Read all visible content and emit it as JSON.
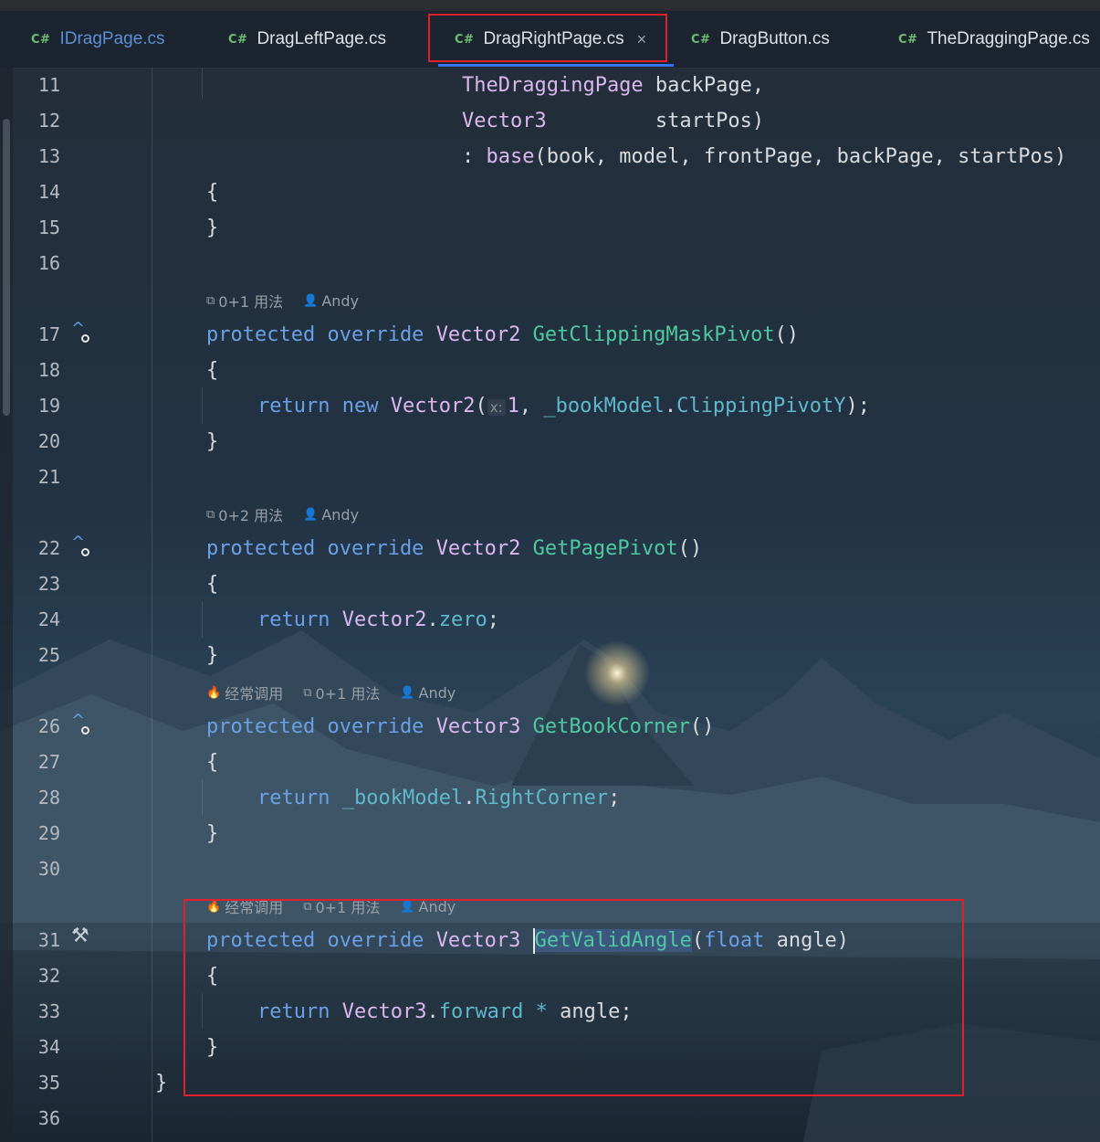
{
  "tabs": [
    {
      "lang": "C#",
      "label": "IDragPage.cs"
    },
    {
      "lang": "C#",
      "label": "DragLeftPage.cs"
    },
    {
      "lang": "C#",
      "label": "DragRightPage.cs",
      "active": true,
      "close": "×"
    },
    {
      "lang": "C#",
      "label": "DragButton.cs"
    },
    {
      "lang": "C#",
      "label": "TheDraggingPage.cs"
    }
  ],
  "meta": {
    "m17": {
      "usages": "0+1 用法",
      "author": "Andy"
    },
    "m22": {
      "usages": "0+2 用法",
      "author": "Andy"
    },
    "m26": {
      "frequent": "经常调用",
      "usages": "0+1 用法",
      "author": "Andy"
    },
    "m31": {
      "frequent": "经常调用",
      "usages": "0+1 用法",
      "author": "Andy"
    }
  },
  "lines": {
    "l11": {
      "n": "11",
      "type": "TheDraggingPage",
      "rest": " backPage,"
    },
    "l12": {
      "n": "12",
      "type": "Vector3",
      "rest": "         startPos)"
    },
    "l13": {
      "n": "13",
      "colon": ": ",
      "base": "base",
      "rest": "(book, model, frontPage, backPage, startPos)"
    },
    "l14": {
      "n": "14",
      "text": "{"
    },
    "l15": {
      "n": "15",
      "text": "}"
    },
    "l16": {
      "n": "16"
    },
    "l17": {
      "n": "17",
      "kw1": "protected",
      "kw2": "override",
      "type": "Vector2",
      "fn": "GetClippingMaskPivot",
      "rest": "()"
    },
    "l18": {
      "n": "18",
      "text": "{"
    },
    "l19": {
      "n": "19",
      "ret": "return",
      "new": "new",
      "type": "Vector2",
      "open": "(",
      "hint": "x:",
      "num": "1",
      "mid": ", ",
      "prop1": "_bookModel",
      "dot": ".",
      "prop2": "ClippingPivotY",
      "end": ");"
    },
    "l20": {
      "n": "20",
      "text": "}"
    },
    "l21": {
      "n": "21"
    },
    "l22": {
      "n": "22",
      "kw1": "protected",
      "kw2": "override",
      "type": "Vector2",
      "fn": "GetPagePivot",
      "rest": "()"
    },
    "l23": {
      "n": "23",
      "text": "{"
    },
    "l24": {
      "n": "24",
      "ret": "return",
      "type": "Vector2",
      "dot": ".",
      "prop": "zero",
      "end": ";"
    },
    "l25": {
      "n": "25",
      "text": "}"
    },
    "l26": {
      "n": "26",
      "kw1": "protected",
      "kw2": "override",
      "type": "Vector3",
      "fn": "GetBookCorner",
      "rest": "()"
    },
    "l27": {
      "n": "27",
      "text": "{"
    },
    "l28": {
      "n": "28",
      "ret": "return",
      "prop1": "_bookModel",
      "dot": ".",
      "prop2": "RightCorner",
      "end": ";"
    },
    "l29": {
      "n": "29",
      "text": "}"
    },
    "l30": {
      "n": "30"
    },
    "l31": {
      "n": "31",
      "kw1": "protected",
      "kw2": "override",
      "type": "Vector3",
      "fn": "GetValidAngle",
      "open": "(",
      "kw3": "float",
      "rest": " angle)"
    },
    "l32": {
      "n": "32",
      "text": "{"
    },
    "l33": {
      "n": "33",
      "ret": "return",
      "type": "Vector3",
      "dot": ".",
      "prop": "forward",
      "op": " * ",
      "rest": "angle;"
    },
    "l34": {
      "n": "34",
      "text": "}"
    },
    "l35": {
      "n": "35",
      "text": "}"
    },
    "l36": {
      "n": "36"
    }
  }
}
